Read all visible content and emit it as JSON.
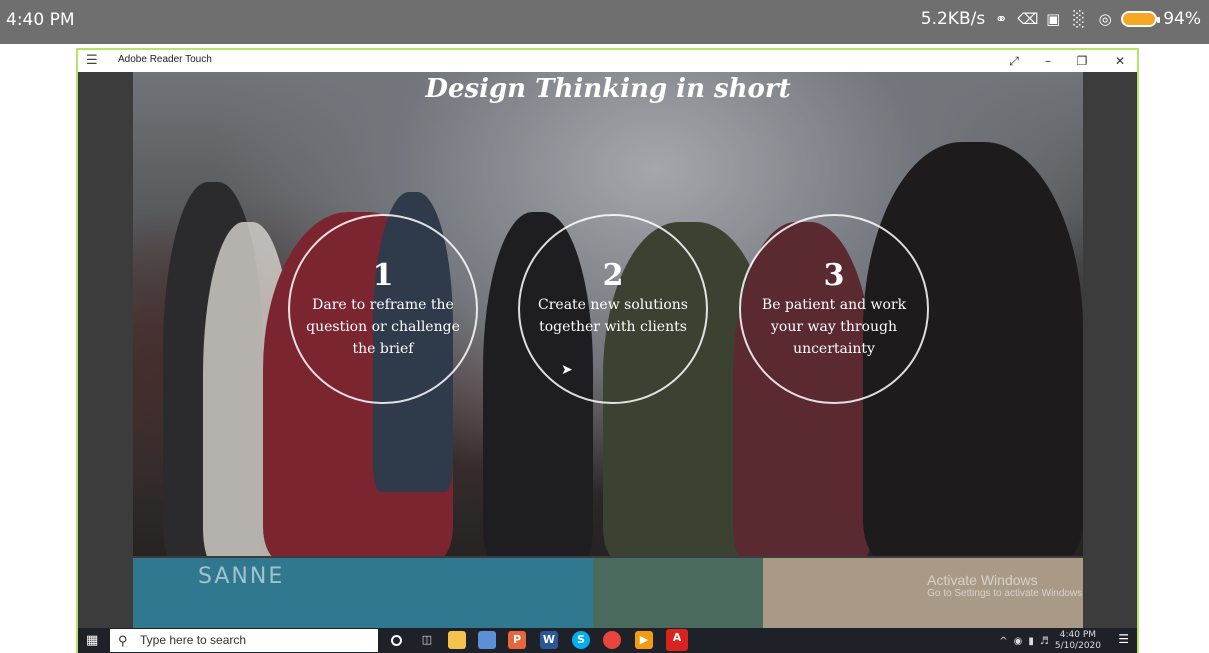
{
  "phone_status": {
    "time": "4:40 PM",
    "net_speed": "5.2KB/s",
    "battery": "94%",
    "battery_color": "#f5a623"
  },
  "window": {
    "title": "Adobe Reader Touch",
    "border_color": "#b6e36a"
  },
  "slide": {
    "title": "Design Thinking in short",
    "steps": [
      {
        "number": "1",
        "text": "Dare to reframe the question or challenge the brief"
      },
      {
        "number": "2",
        "text": "Create new solutions together with clients"
      },
      {
        "number": "3",
        "text": "Be patient and work your way through uncertainty"
      }
    ],
    "filmstrip_text": "SANNE"
  },
  "watermark": {
    "line1": "Activate Windows",
    "line2": "Go to Settings to activate Windows."
  },
  "taskbar": {
    "search_placeholder": "Type here to search",
    "apps": [
      "cortana-circle",
      "task-view",
      "file-explorer",
      "notes",
      "paint",
      "word",
      "skype",
      "chrome",
      "media",
      "acrobat"
    ],
    "clock_time": "4:40 PM",
    "clock_date": "5/10/2020"
  }
}
